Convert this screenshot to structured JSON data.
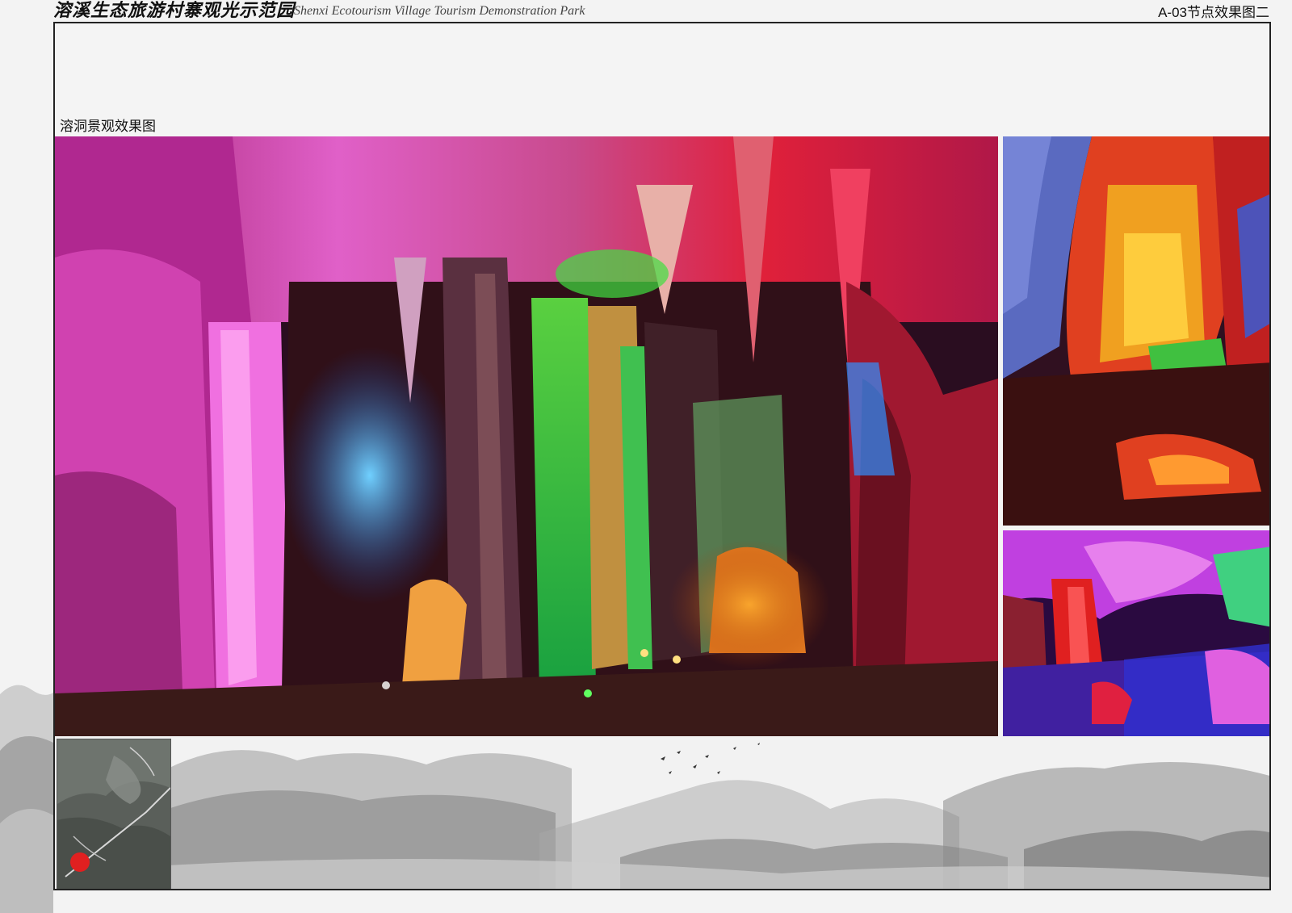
{
  "header": {
    "title_cn": "溶溪生态旅游村寨观光示范园",
    "title_en": "Shenxi Ecotourism Village Tourism Demonstration Park",
    "sheet_code": "A-03节点效果图二"
  },
  "section": {
    "title": "溶洞景观效果图"
  },
  "images": {
    "main": "karst-cave-colorful-lighting",
    "side_top": "cave-orange-green-lighting",
    "side_bottom": "cave-purple-red-pool"
  },
  "colors": {
    "frame_border": "#222222",
    "location_marker": "#e02020"
  }
}
